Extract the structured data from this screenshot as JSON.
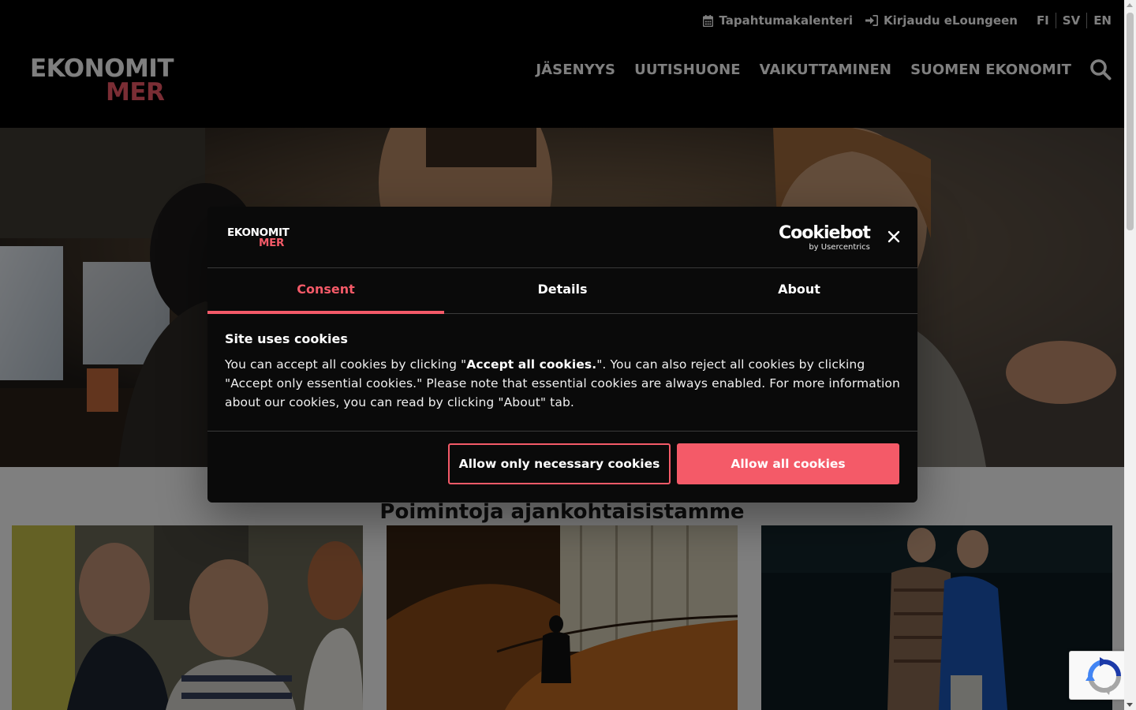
{
  "header": {
    "utility": {
      "calendar_label": "Tapahtumakalenteri",
      "login_label": "Kirjaudu eLoungeen",
      "languages": [
        "FI",
        "SV",
        "EN"
      ]
    },
    "logo": {
      "line1": "EKONOMIT",
      "line2": "MER"
    },
    "nav": [
      "JÄSENYYS",
      "UUTISHUONE",
      "VAIKUTTAMINEN",
      "SUOMEN EKONOMIT"
    ]
  },
  "main": {
    "section_heading": "Poimintoja ajankohtaisistamme"
  },
  "cookie_dialog": {
    "logo": {
      "line1": "EKONOMIT",
      "line2": "MER"
    },
    "provider": {
      "name": "Cookiebot",
      "sub": "by Usercentrics"
    },
    "tabs": [
      "Consent",
      "Details",
      "About"
    ],
    "active_tab": "Consent",
    "title": "Site uses cookies",
    "body": {
      "p1": "You can accept all cookies by clicking \"",
      "strong": "Accept all cookies.",
      "p2": "\". You can also reject all cookies by clicking \"Accept only essential cookies.\" Please note that essential cookies are always enabled. For more information about our cookies, you can read by clicking \"About\" tab."
    },
    "buttons": {
      "necessary": "Allow only necessary cookies",
      "all": "Allow all cookies"
    }
  },
  "colors": {
    "accent": "#f45a68",
    "header_bg": "#000000",
    "dialog_bg": "#0a0a0a"
  },
  "icons": {
    "calendar": "calendar-icon",
    "login": "sign-in-icon",
    "search": "search-icon",
    "close": "close-icon"
  }
}
